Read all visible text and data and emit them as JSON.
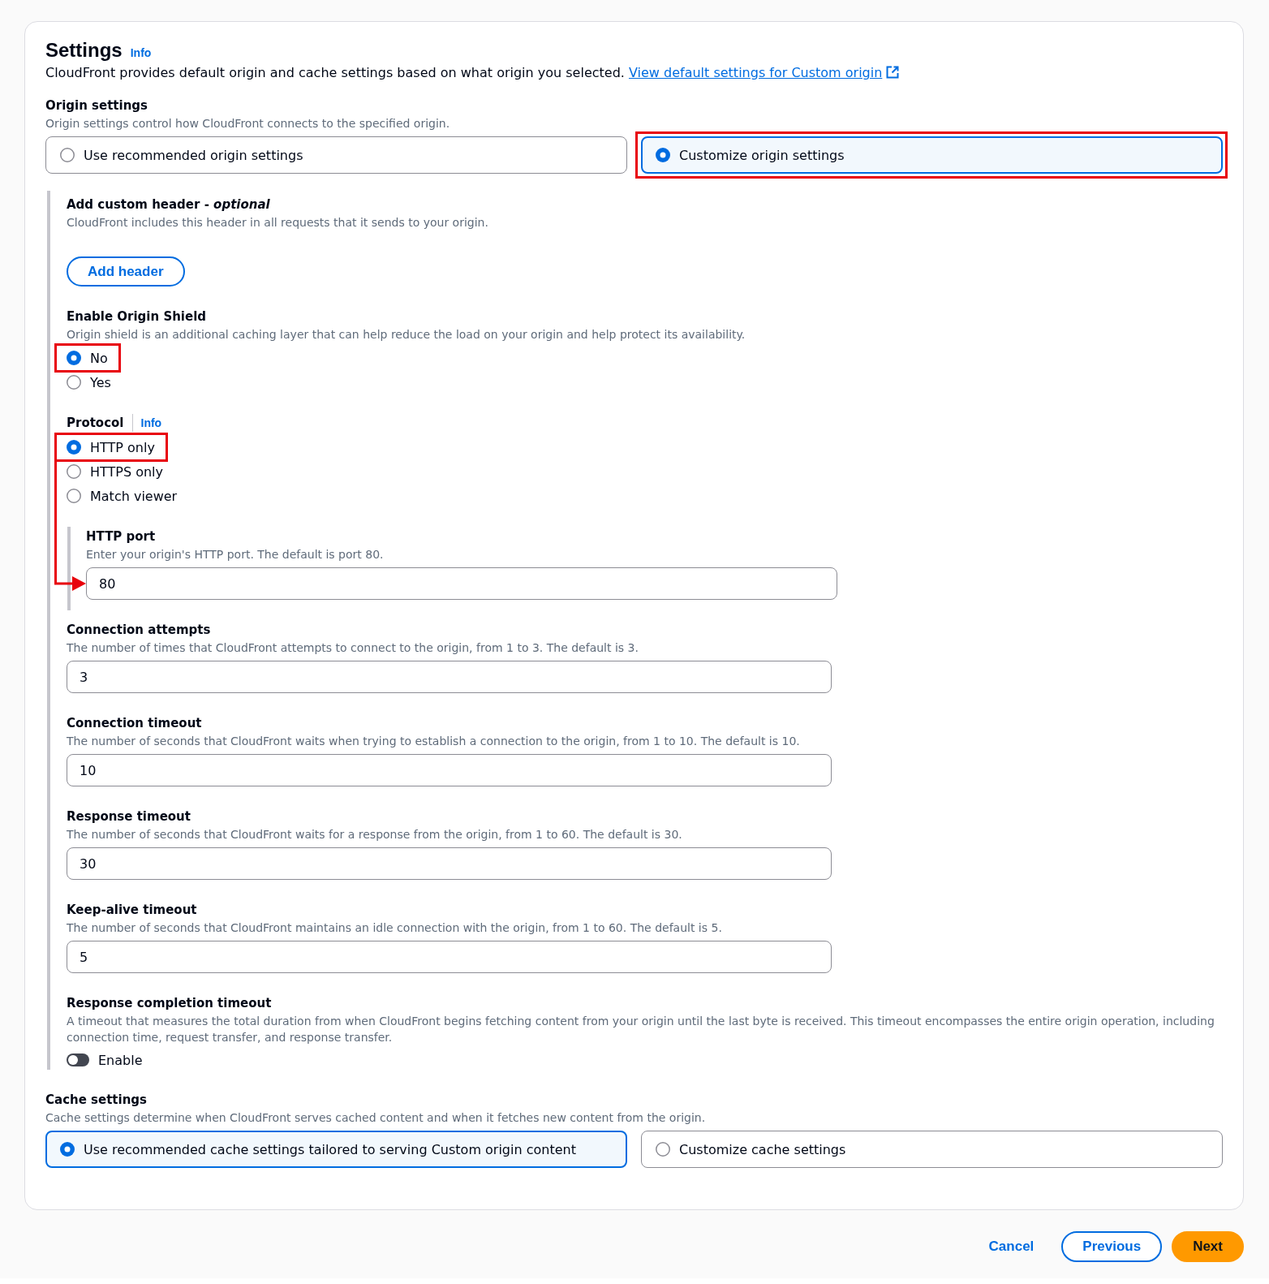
{
  "settings": {
    "title": "Settings",
    "info_link": "Info",
    "description": "CloudFront provides default origin and cache settings based on what origin you selected.",
    "doc_link": "View default settings for Custom origin"
  },
  "origin_settings": {
    "label": "Origin settings",
    "description": "Origin settings control how CloudFront connects to the specified origin.",
    "options": [
      {
        "label": "Use recommended origin settings",
        "selected": false,
        "highlighted": false
      },
      {
        "label": "Customize origin settings",
        "selected": true,
        "highlighted": true
      }
    ]
  },
  "custom_origin_settings": {
    "custom_header": {
      "label": "Add custom header - *optional*",
      "description": "CloudFront includes this header in all requests that it sends to your origin.",
      "button": "Add header"
    },
    "origin_shield": {
      "label": "Enable Origin Shield",
      "description": "Origin shield is an additional caching layer that can help reduce the load on your origin and help protect its availability.",
      "options": [
        {
          "label": "No",
          "selected": true,
          "highlighted": true
        },
        {
          "label": "Yes",
          "selected": false,
          "highlighted": false
        }
      ]
    },
    "protocol": {
      "label": "Protocol",
      "info_link": "Info",
      "options": [
        {
          "label": "HTTP only",
          "selected": true,
          "highlighted": true
        },
        {
          "label": "HTTPS only",
          "selected": false,
          "highlighted": false
        },
        {
          "label": "Match viewer",
          "selected": false,
          "highlighted": false
        }
      ],
      "http_port": {
        "label": "HTTP port",
        "description": "Enter your origin's HTTP port. The default is port 80.",
        "value": "80",
        "arrow_pointer": true
      }
    },
    "fields": [
      {
        "label": "Connection attempts",
        "description": "The number of times that CloudFront attempts to connect to the origin, from 1 to 3. The default is 3.",
        "value": "3"
      },
      {
        "label": "Connection timeout",
        "description": "The number of seconds that CloudFront waits when trying to establish a connection to the origin, from 1 to 10. The default is 10.",
        "value": "10"
      },
      {
        "label": "Response timeout",
        "description": "The number of seconds that CloudFront waits for a response from the origin, from 1 to 60. The default is 30.",
        "value": "30"
      },
      {
        "label": "Keep-alive timeout",
        "description": "The number of seconds that CloudFront maintains an idle connection with the origin, from 1 to 60. The default is 5.",
        "value": "5"
      }
    ],
    "response_completion_timeout": {
      "label": "Response completion timeout",
      "description": "A timeout that measures the total duration from when CloudFront begins fetching content from your origin until the last byte is received. This timeout encompasses the entire origin operation, including connection time, request transfer, and response transfer.",
      "toggle": {
        "label": "Enable",
        "on": false
      }
    }
  },
  "cache_settings": {
    "label": "Cache settings",
    "description": "Cache settings determine when CloudFront serves cached content and when it fetches new content from the origin.",
    "options": [
      {
        "label": "Use recommended cache settings tailored to serving Custom origin content",
        "selected": true,
        "highlighted": false
      },
      {
        "label": "Customize cache settings",
        "selected": false,
        "highlighted": false
      }
    ]
  },
  "footer": {
    "buttons": [
      {
        "label": "Cancel",
        "kind": "link"
      },
      {
        "label": "Previous",
        "kind": "secondary"
      },
      {
        "label": "Next",
        "kind": "primary"
      }
    ]
  }
}
